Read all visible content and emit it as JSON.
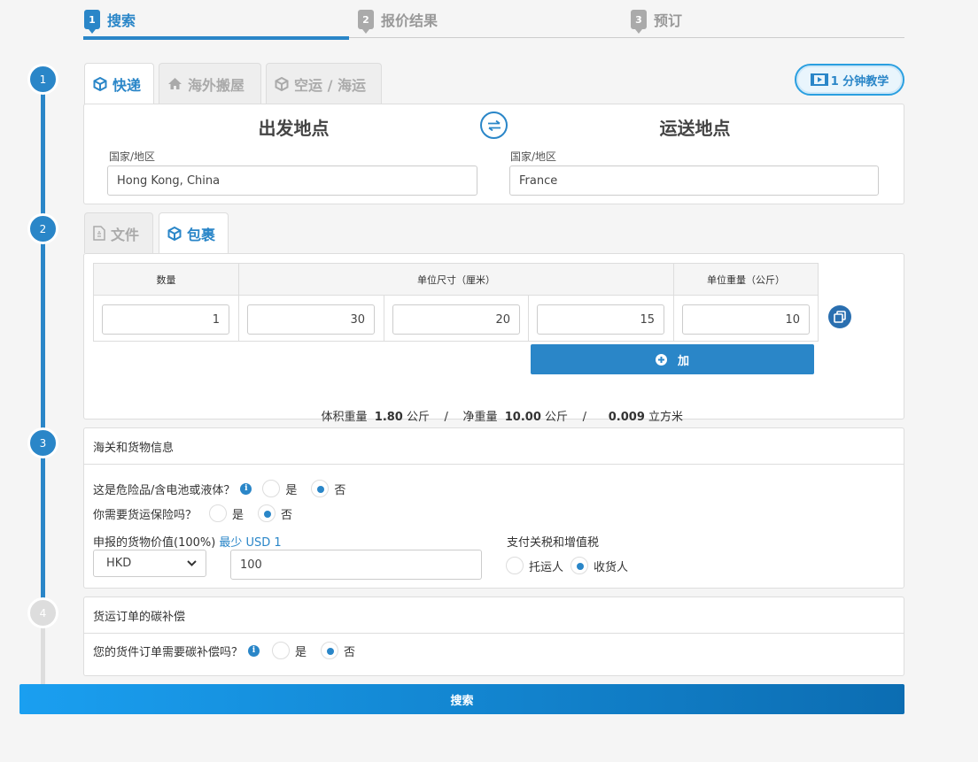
{
  "steps": [
    {
      "num": "1",
      "label": "搜索"
    },
    {
      "num": "2",
      "label": "报价结果"
    },
    {
      "num": "3",
      "label": "预订"
    }
  ],
  "rail": [
    "1",
    "2",
    "3",
    "4"
  ],
  "service_tabs": [
    {
      "label": "快递",
      "icon": "cube-icon"
    },
    {
      "label": "海外搬屋",
      "icon": "home-icon"
    },
    {
      "label": "空运 / 海运",
      "icon": "cube-icon"
    }
  ],
  "tutorial": {
    "label": "1 分钟教学",
    "icon": "film-icon"
  },
  "origin": {
    "title": "出发地点",
    "field_label": "国家/地区",
    "value": "Hong Kong, China"
  },
  "destination": {
    "title": "运送地点",
    "field_label": "国家/地区",
    "value": "France"
  },
  "type_tabs": [
    {
      "label": "文件",
      "icon": "document-icon"
    },
    {
      "label": "包裹",
      "icon": "cube-icon"
    }
  ],
  "package": {
    "headers": {
      "qty": "数量",
      "dims": "单位尺寸（厘米）",
      "weight": "单位重量（公斤）"
    },
    "row": {
      "qty": "1",
      "length": "30",
      "width": "20",
      "height": "15",
      "weight": "10"
    },
    "add_label": "加",
    "summary": {
      "vol_label": "体积重量",
      "vol_value": "1.80",
      "vol_unit": "公斤",
      "sep": "/",
      "net_label": "净重量",
      "net_value": "10.00",
      "net_unit": "公斤",
      "cbm_value": "0.009",
      "cbm_unit": "立方米"
    }
  },
  "customs": {
    "title": "海关和货物信息",
    "dangerous_q": "这是危险品/含电池或液体？",
    "insurance_q": "你需要货运保险吗？",
    "yes": "是",
    "no": "否",
    "declared_label": "申报的货物价值(100%)",
    "min_label": "最少 USD 1",
    "currency": "HKD",
    "declared_value": "100",
    "tax_label": "支付关税和增值税",
    "shipper": "托运人",
    "consignee": "收货人"
  },
  "carbon": {
    "title": "货运订单的碳补偿",
    "question": "您的货件订单需要碳补偿吗？",
    "yes": "是",
    "no": "否"
  },
  "search_button": "搜索",
  "colors": {
    "accent": "#2a86c8",
    "button_gradient_start": "#1a9ff0",
    "button_gradient_end": "#0c6db2"
  }
}
